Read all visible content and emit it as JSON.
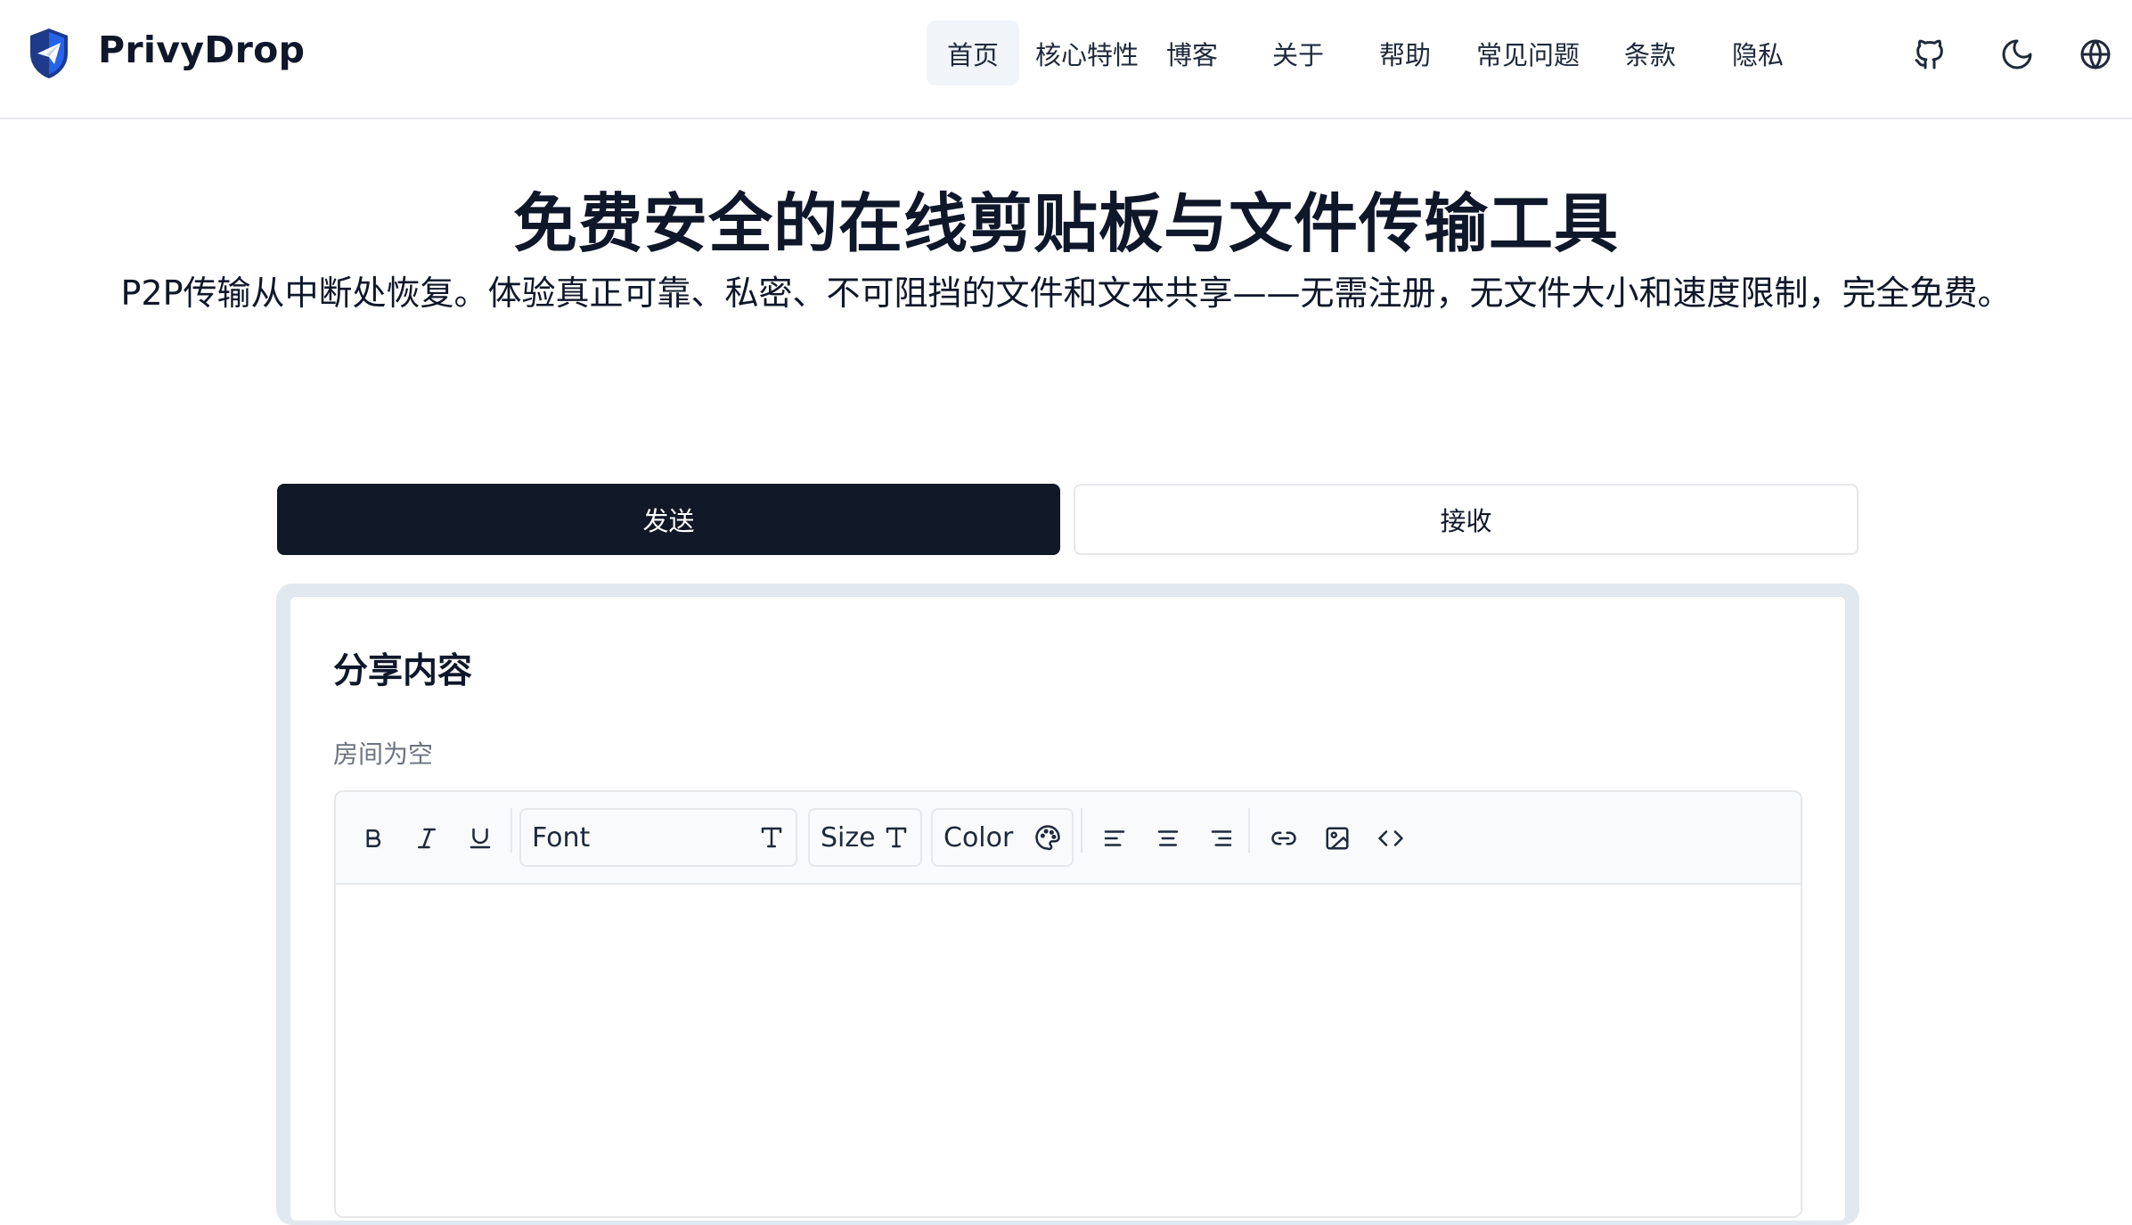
{
  "brand": {
    "name": "PrivyDrop",
    "accent": "#1d4ed8"
  },
  "nav": {
    "items": [
      {
        "label": "首页",
        "active": true
      },
      {
        "label": "核心特性",
        "active": false
      },
      {
        "label": "博客",
        "active": false
      },
      {
        "label": "关于",
        "active": false
      },
      {
        "label": "帮助",
        "active": false
      },
      {
        "label": "常见问题",
        "active": false
      },
      {
        "label": "条款",
        "active": false
      },
      {
        "label": "隐私",
        "active": false
      }
    ],
    "icons": [
      "github-icon",
      "moon-icon",
      "globe-icon"
    ]
  },
  "hero": {
    "title": "免费安全的在线剪贴板与文件传输工具",
    "subtitle": "P2P传输从中断处恢复。体验真正可靠、私密、不可阻挡的文件和文本共享——无需注册，无文件大小和速度限制，完全免费。"
  },
  "tabs": {
    "send": "发送",
    "receive": "接收",
    "active": "send"
  },
  "card": {
    "title": "分享内容",
    "room_status": "房间为空"
  },
  "editor": {
    "toolbar": {
      "bold": "bold-icon",
      "italic": "italic-icon",
      "underline": "underline-icon",
      "font_label": "Font",
      "size_label": "Size",
      "color_label": "Color",
      "align_left": "align-left-icon",
      "align_center": "align-center-icon",
      "align_right": "align-right-icon",
      "link": "link-icon",
      "image": "image-icon",
      "code": "code-icon"
    },
    "content": ""
  },
  "colors": {
    "dark": "#111827",
    "border": "#e5e7eb",
    "muted": "#6b7280",
    "card_frame": "#e2e8f0"
  }
}
